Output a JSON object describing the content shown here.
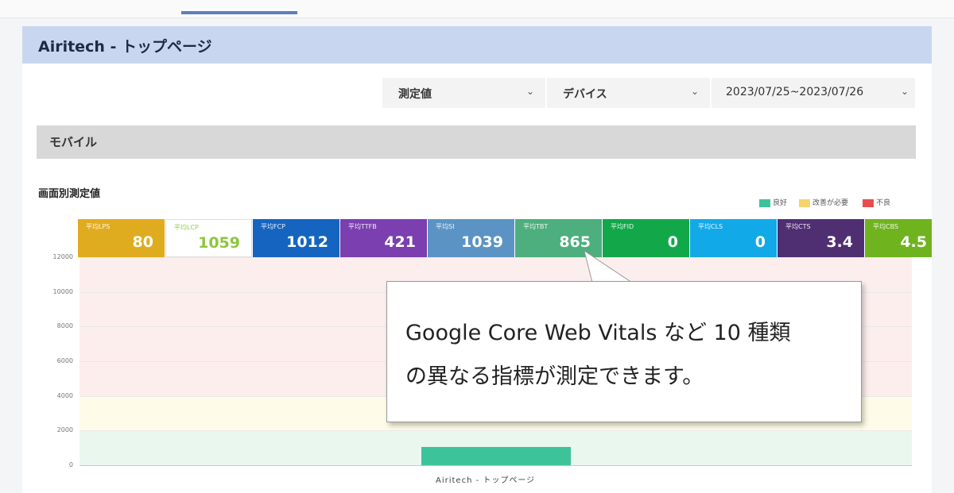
{
  "page": {
    "title": "Airitech - トップページ"
  },
  "filters": {
    "metric": {
      "label": "測定値"
    },
    "device": {
      "label": "デバイス"
    },
    "date_range": {
      "label": "2023/07/25~2023/07/26"
    }
  },
  "section": {
    "title": "モバイル"
  },
  "chart": {
    "title": "画面別測定値",
    "legend": [
      {
        "label": "良好",
        "color": "#3dc39a"
      },
      {
        "label": "改善が必要",
        "color": "#f7d46b"
      },
      {
        "label": "不良",
        "color": "#e84d4d"
      }
    ],
    "y_ticks": [
      "12000",
      "10000",
      "8000",
      "6000",
      "4000",
      "2000",
      "0"
    ],
    "x_label": "Airitech - トップページ"
  },
  "metrics": [
    {
      "label": "平均LPS",
      "value": "80",
      "color": "#e0ac1f",
      "text_color": "#ffffff"
    },
    {
      "label": "平均LCP",
      "value": "1059",
      "color": "#ffffff",
      "text_color": "#8cc63e"
    },
    {
      "label": "平均FCP",
      "value": "1012",
      "color": "#1565c0",
      "text_color": "#ffffff"
    },
    {
      "label": "平均TTFB",
      "value": "421",
      "color": "#7b3fb0",
      "text_color": "#ffffff"
    },
    {
      "label": "平均SI",
      "value": "1039",
      "color": "#5b94c4",
      "text_color": "#ffffff"
    },
    {
      "label": "平均TBT",
      "value": "865",
      "color": "#4caf7d",
      "text_color": "#ffffff"
    },
    {
      "label": "平均FID",
      "value": "0",
      "color": "#12a84a",
      "text_color": "#ffffff"
    },
    {
      "label": "平均CLS",
      "value": "0",
      "color": "#12a9e8",
      "text_color": "#ffffff"
    },
    {
      "label": "平均CTS",
      "value": "3.4",
      "color": "#4f2f72",
      "text_color": "#ffffff"
    },
    {
      "label": "平均CBS",
      "value": "4.5",
      "color": "#6fb31f",
      "text_color": "#ffffff"
    }
  ],
  "chart_data": {
    "type": "bar",
    "categories": [
      "Airitech - トップページ"
    ],
    "values": [
      1059
    ],
    "ylim": [
      0,
      12000
    ],
    "bands": [
      {
        "from": 0,
        "to": 2000,
        "color": "#eaf7ef"
      },
      {
        "from": 2000,
        "to": 4000,
        "color": "#fefbe8"
      },
      {
        "from": 4000,
        "to": 12000,
        "color": "#fdeeee"
      }
    ]
  },
  "callout": {
    "line1": "Google Core Web Vitals など 10 種類",
    "line2": "の異なる指標が測定できます。"
  }
}
